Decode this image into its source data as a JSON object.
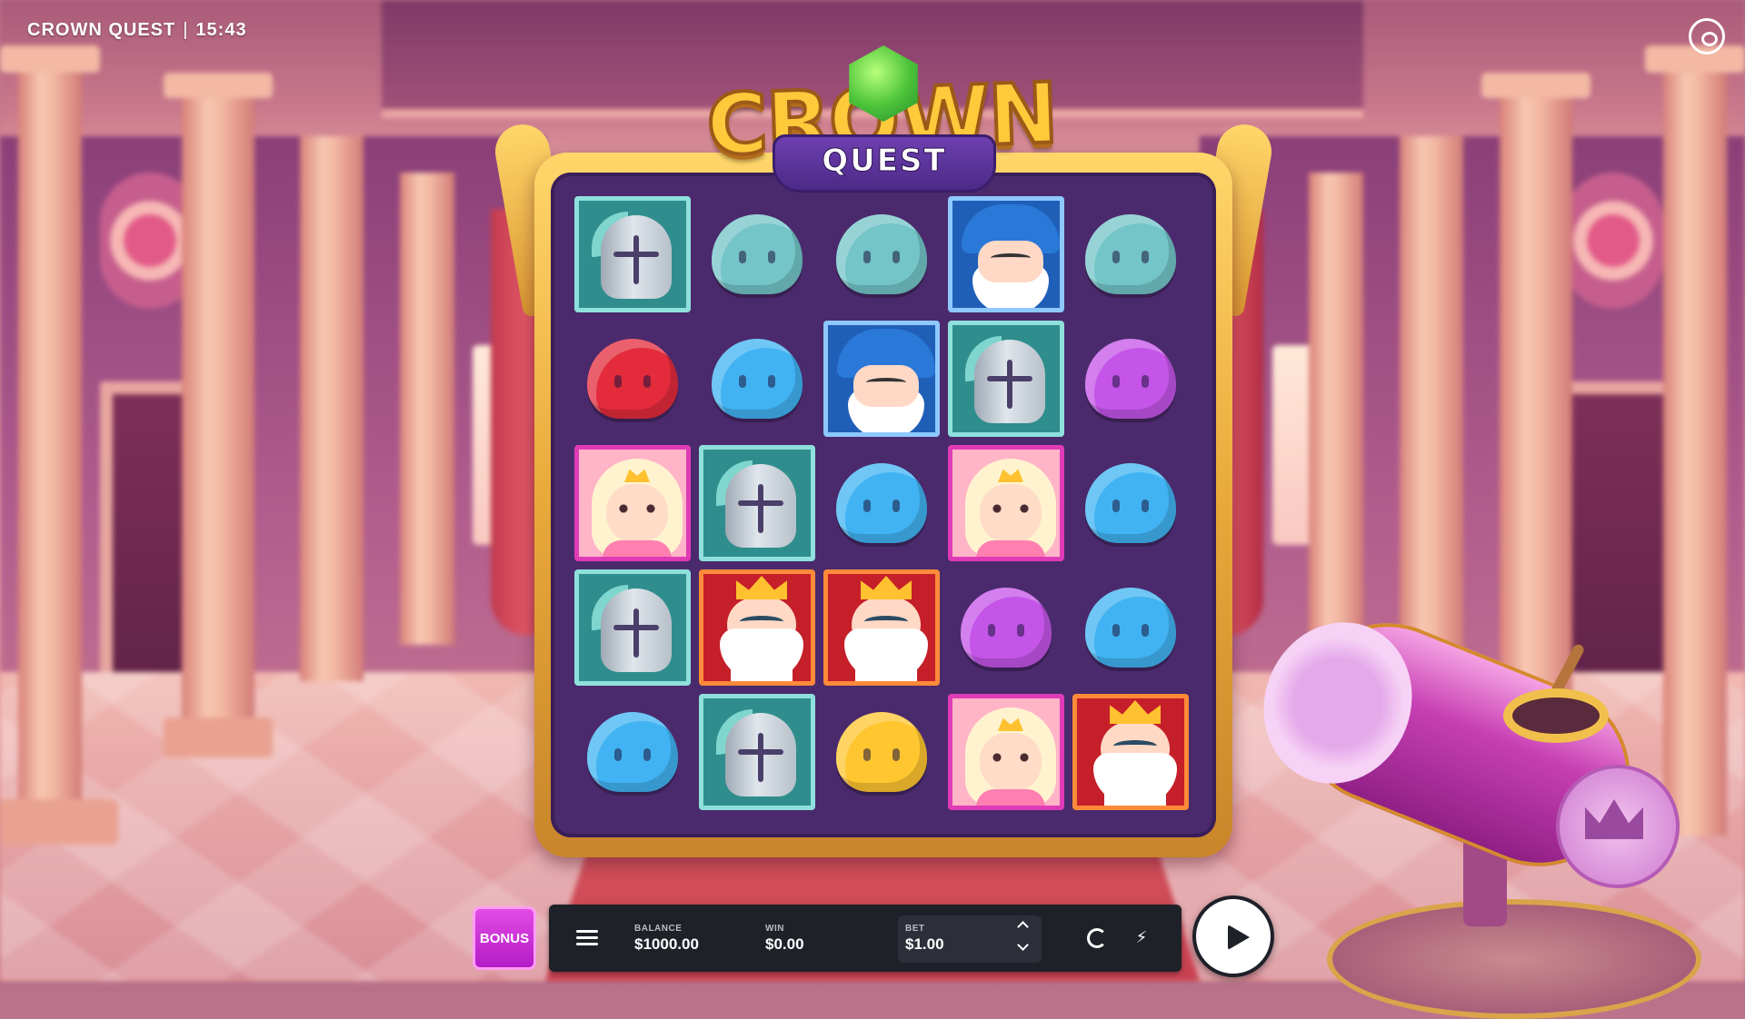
{
  "hud": {
    "game_name": "CROWN QUEST",
    "separator": "|",
    "clock": "15:43",
    "settings_icon": "eye-circle-icon"
  },
  "logo": {
    "word_top": "CROWN",
    "word_bottom": "QUEST"
  },
  "grid": {
    "rows": 5,
    "cols": 5,
    "cells": [
      [
        "knight",
        "slime-teal",
        "slime-teal",
        "wizard",
        "slime-teal"
      ],
      [
        "slime-red",
        "slime-blue",
        "wizard",
        "knight",
        "slime-purple"
      ],
      [
        "princess",
        "knight",
        "slime-blue",
        "princess",
        "slime-blue"
      ],
      [
        "knight",
        "king",
        "king",
        "slime-purple",
        "slime-blue"
      ],
      [
        "slime-blue",
        "knight",
        "slime-yellow",
        "princess",
        "king"
      ]
    ]
  },
  "bottom_bar": {
    "bonus_label": "BONUS",
    "balance_label": "BALANCE",
    "balance_value": "$1000.00",
    "win_label": "WIN",
    "win_value": "$0.00",
    "bet_label": "BET",
    "bet_value": "$1.00",
    "icons": [
      "menu-icon",
      "bet-up-icon",
      "bet-down-icon",
      "autoplay-icon",
      "turbo-icon",
      "spin-play-icon"
    ]
  },
  "colors": {
    "knight_tile": "#2f8e8d",
    "wizard_tile": "#1f5fb8",
    "princess_tile": "#ffb4c8",
    "king_tile": "#c51f2a",
    "board": "#4a2a6c",
    "frame_gold": "#e9a83a",
    "bonus_button": "#c624d6",
    "panel": "#1f2129"
  }
}
